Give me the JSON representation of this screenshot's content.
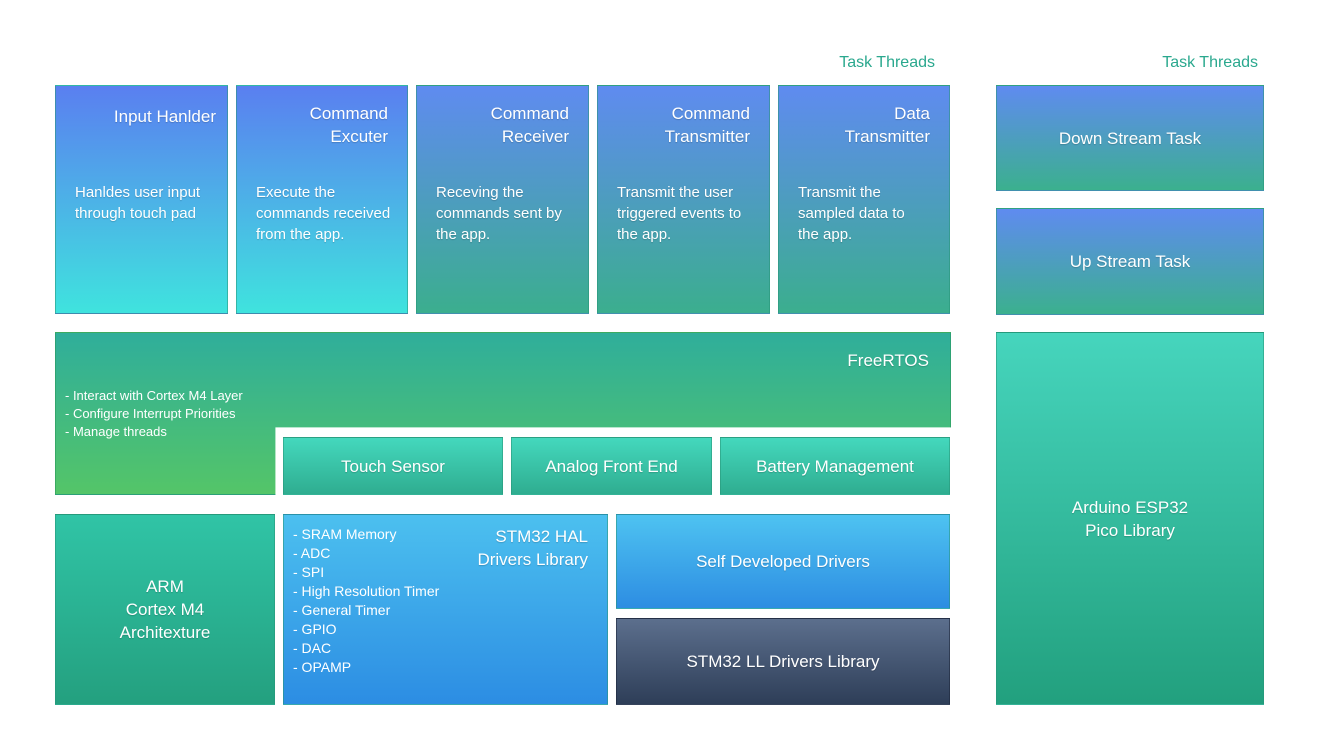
{
  "headings": {
    "left": "Task Threads",
    "right": "Task Threads"
  },
  "tasks": [
    {
      "title": "Input Hanlder",
      "desc": "Hanldes user input\nthrough touch pad"
    },
    {
      "title": "Command\nExcuter",
      "desc": "Execute the\ncommands received\nfrom the app."
    },
    {
      "title": "Command\nReceiver",
      "desc": "Receving the\ncommands sent by\nthe app."
    },
    {
      "title": "Command\nTransmitter",
      "desc": "Transmit the user\ntriggered events to\nthe app."
    },
    {
      "title": "Data\nTransmitter",
      "desc": "Transmit the\nsampled data to\nthe app."
    }
  ],
  "side_tasks": {
    "down": "Down Stream Task",
    "up": "Up Stream Task"
  },
  "freertos": {
    "title": "FreeRTOS",
    "items": [
      "- Interact with Cortex M4 Layer",
      "- Configure Interrupt Priorities",
      "- Manage threads"
    ]
  },
  "peripherals": {
    "touch": "Touch Sensor",
    "afe": "Analog Front End",
    "battery": "Battery Management"
  },
  "arm": "ARM\nCortex M4\nArchitexture",
  "hal": {
    "title": "STM32 HAL\nDrivers Library",
    "items": [
      "- SRAM Memory",
      "- ADC",
      "- SPI",
      "- High Resolution Timer",
      "- General Timer",
      "- GPIO",
      "- DAC",
      "- OPAMP"
    ]
  },
  "self_drivers": "Self Developed Drivers",
  "ll_drivers": "STM32 LL Drivers Library",
  "esp32": "Arduino ESP32\nPico Library",
  "colors": {
    "heading": "#2aa88e",
    "task_gradient_top": "#5a7ff0",
    "task_gradient_bottom": "#3fe3de",
    "rtos_green": "#54c568",
    "hal_blue": "#2c8de3",
    "ll_dark": "#2e3e58"
  }
}
